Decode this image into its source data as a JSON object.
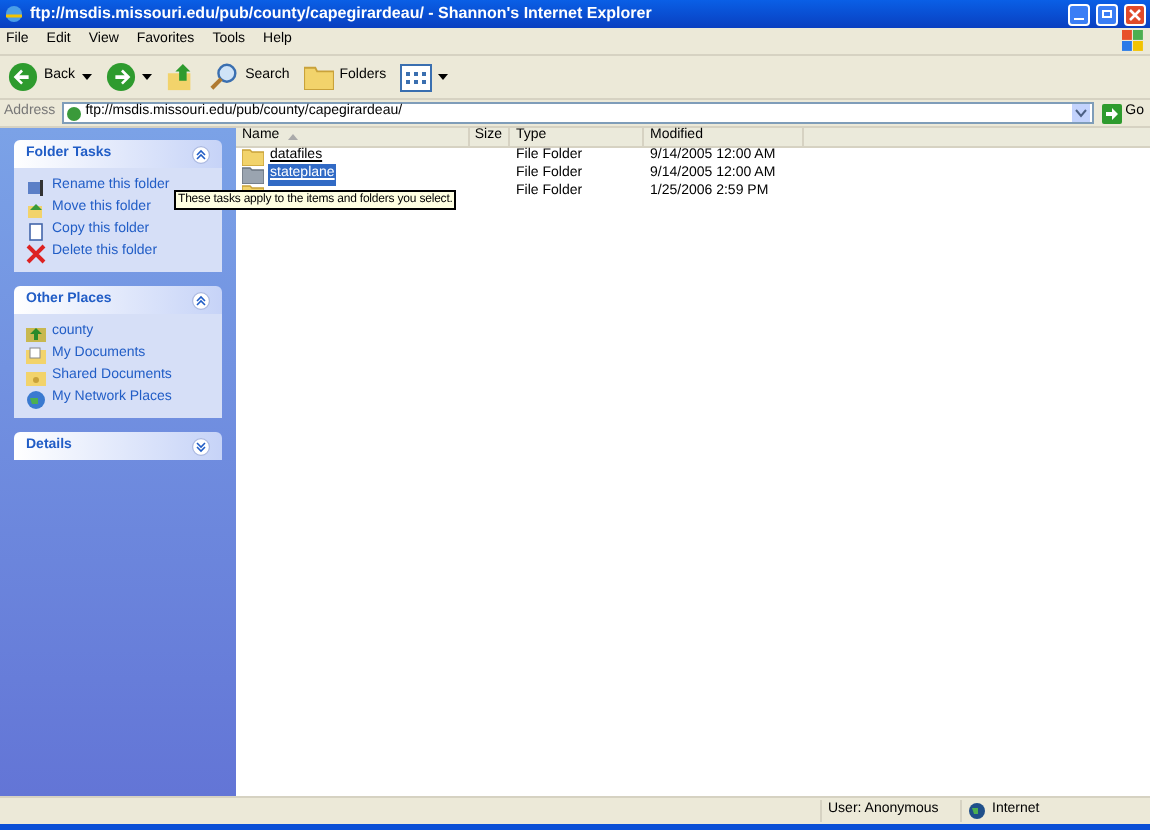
{
  "window": {
    "title": "ftp://msdis.missouri.edu/pub/county/capegirardeau/ - Shannon's Internet Explorer"
  },
  "menu": [
    "File",
    "Edit",
    "View",
    "Favorites",
    "Tools",
    "Help"
  ],
  "toolbar": [
    {
      "kind": "back",
      "label": "Back"
    },
    {
      "kind": "forward"
    },
    {
      "kind": "up"
    },
    {
      "kind": "search",
      "label": "Search"
    },
    {
      "kind": "folders",
      "label": "Folders"
    },
    {
      "kind": "views"
    }
  ],
  "address": {
    "label": "Address",
    "value": "ftp://msdis.missouri.edu/pub/county/capegirardeau/",
    "go": "Go"
  },
  "sidebar": [
    {
      "title": "Folder Tasks",
      "expanded": true,
      "items": [
        {
          "kind": "rename",
          "label": "Rename this folder"
        },
        {
          "kind": "move",
          "label": "Move this folder"
        },
        {
          "kind": "copy",
          "label": "Copy this folder"
        },
        {
          "kind": "delete",
          "label": "Delete this folder"
        }
      ]
    },
    {
      "title": "Other Places",
      "expanded": true,
      "items": [
        {
          "kind": "up",
          "label": "county"
        },
        {
          "kind": "docs",
          "label": "My Documents"
        },
        {
          "kind": "shared",
          "label": "Shared Documents"
        },
        {
          "kind": "network",
          "label": "My Network Places"
        }
      ]
    },
    {
      "title": "Details",
      "expanded": false
    }
  ],
  "table": {
    "columns": [
      "Name",
      "Size",
      "Type",
      "Modified"
    ],
    "rows": [
      {
        "name": "datafiles",
        "type": "File Folder",
        "modified": "9/14/2005 12:00 AM",
        "selected": false
      },
      {
        "name": "stateplane",
        "type": "File Folder",
        "modified": "9/14/2005 12:00 AM",
        "selected": true
      },
      {
        "type": "File Folder",
        "modified": "1/25/2006 2:59 PM",
        "selected": false
      }
    ]
  },
  "tooltip": "These tasks apply to the items and folders you select.",
  "status_bar": {
    "user": "User: Anonymous",
    "zone": "Internet"
  }
}
